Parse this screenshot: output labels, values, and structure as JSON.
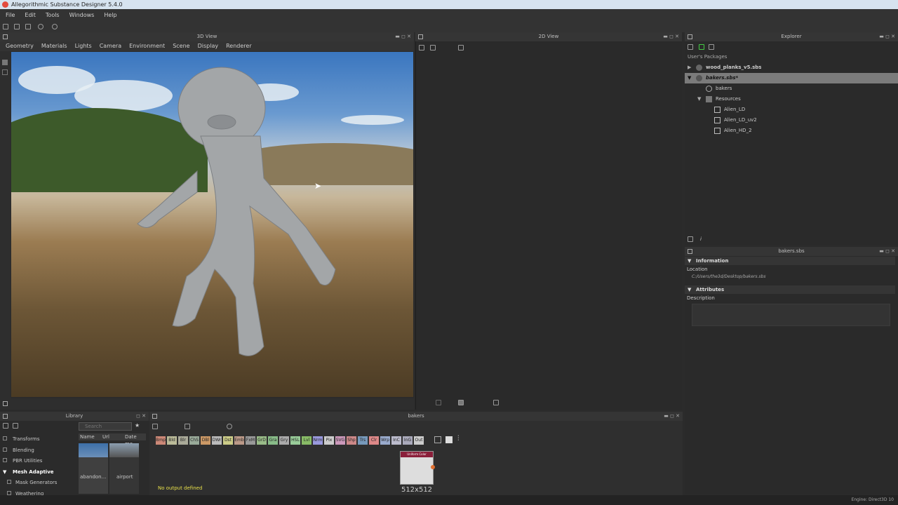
{
  "window": {
    "title": "Allegorithmic Substance Designer 5.4.0"
  },
  "menu": [
    "File",
    "Edit",
    "Tools",
    "Windows",
    "Help"
  ],
  "view3d": {
    "title": "3D View",
    "menu": [
      "Geometry",
      "Materials",
      "Lights",
      "Camera",
      "Environment",
      "Scene",
      "Display",
      "Renderer"
    ]
  },
  "view2d": {
    "title": "2D View"
  },
  "explorer": {
    "title": "Explorer",
    "section": "User's Packages",
    "items": [
      {
        "label": "wood_planks_v5.sbs"
      },
      {
        "label": "bakers.sbs*"
      },
      {
        "label": "bakers"
      },
      {
        "label": "Resources"
      },
      {
        "label": "Alien_LD"
      },
      {
        "label": "Alien_LD_uv2"
      },
      {
        "label": "Alien_HD_2"
      }
    ]
  },
  "properties": {
    "title": "bakers.sbs",
    "information_label": "Information",
    "location_label": "Location",
    "location_value": "C:/Users/the3d/Desktop/bakers.sbs",
    "attributes_label": "Attributes",
    "description_label": "Description"
  },
  "library": {
    "title": "Library",
    "search_placeholder": "Search",
    "columns": [
      "Name",
      "Url",
      "Date mo"
    ],
    "categories": [
      "Transforms",
      "Blending",
      "PBR Utilities",
      "Mesh Adaptive",
      "Mask Generators",
      "Weathering"
    ],
    "thumbs": [
      "abandon...",
      "airport"
    ]
  },
  "graph": {
    "title": "bakers",
    "chips": [
      "Bmp",
      "Bld",
      "Blr",
      "ChS",
      "DBl",
      "DWr",
      "Dst",
      "Emb",
      "FxM",
      "GrD",
      "Gra",
      "Gry",
      "HSL",
      "Lvl",
      "Nrm",
      "Pix",
      "SVG",
      "Shp",
      "Trs",
      "Clr",
      "Wrp",
      "InC",
      "InG",
      "Out"
    ],
    "node_title": "Uniform Color",
    "node_size": "512x512",
    "no_output": "No output defined"
  },
  "statusbar": {
    "engine": "Engine: Direct3D 10"
  }
}
